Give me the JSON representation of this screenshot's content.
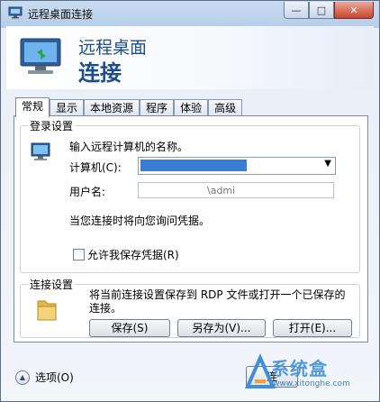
{
  "window": {
    "title": "远程桌面连接",
    "minimize": "—",
    "maximize": "□",
    "close": "✕"
  },
  "banner": {
    "line1": "远程桌面",
    "line2": "连接"
  },
  "tabs": [
    {
      "label": "常规",
      "active": true
    },
    {
      "label": "显示"
    },
    {
      "label": "本地资源"
    },
    {
      "label": "程序"
    },
    {
      "label": "体验"
    },
    {
      "label": "高级"
    }
  ],
  "login_settings": {
    "group_title": "登录设置",
    "instruction": "输入远程计算机的名称。",
    "computer_label": "计算机(C):",
    "username_label": "用户名:",
    "username_partial": "\\admi",
    "credential_note": "当您连接时将向您询问凭据。",
    "save_credentials_label": "允许我保存凭据(R)"
  },
  "connection_settings": {
    "group_title": "连接设置",
    "description": "将当前连接设置保存到 RDP 文件或打开一个已保存的连接。",
    "save_button": "保存(S)",
    "save_as_button": "另存为(V)...",
    "open_button": "打开(E)..."
  },
  "footer": {
    "options_label": "选项(O)",
    "connect_fragment": "连"
  },
  "watermark": {
    "text": "系统盒",
    "url": "www.xitonghe.com"
  }
}
